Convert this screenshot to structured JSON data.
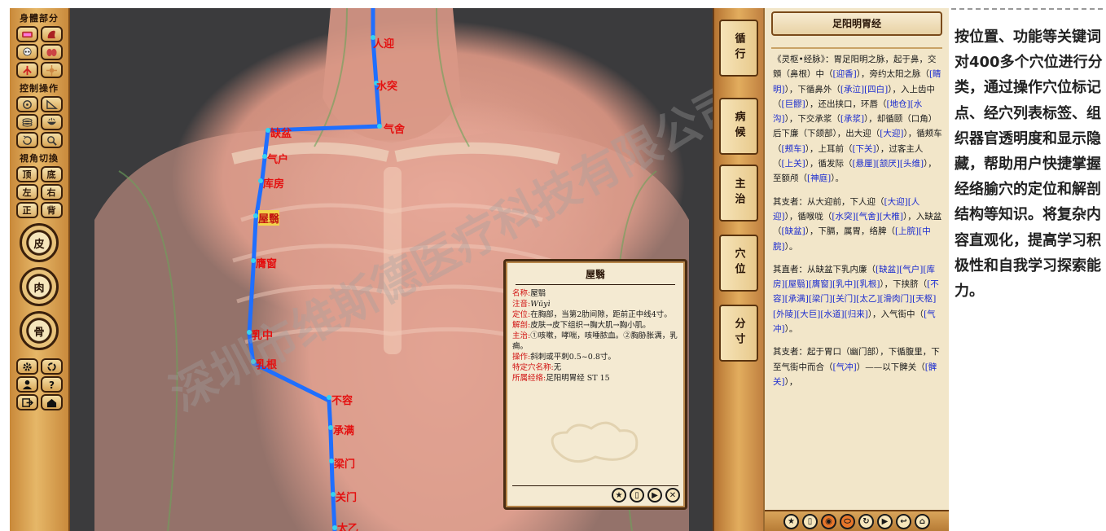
{
  "left_toolbar": {
    "section_body": "身體部分",
    "section_control": "控制操作",
    "section_view": "視角切換",
    "body_icons": [
      "skin-icon",
      "muscle-icon",
      "skull-icon",
      "organ-icon",
      "vessel-icon",
      "nerve-icon"
    ],
    "control_icons": [
      "rotate-icon",
      "measure-icon",
      "layers-icon",
      "bowl-icon",
      "reset-icon",
      "zoom-icon"
    ],
    "view_buttons": [
      "顶",
      "底",
      "左",
      "右",
      "正",
      "背"
    ],
    "ring_buttons": [
      "皮",
      "肉",
      "骨"
    ],
    "bottom_icons": [
      "settings-icon",
      "refresh-icon",
      "person-icon",
      "help-icon",
      "exit-icon",
      "home-icon"
    ]
  },
  "viewport": {
    "watermark": "深圳市维斯德医疗科技有限公司",
    "points": [
      {
        "label": "人迎"
      },
      {
        "label": "水突"
      },
      {
        "label": "气舍"
      },
      {
        "label": "缺盆"
      },
      {
        "label": "气户"
      },
      {
        "label": "库房"
      },
      {
        "label": "屋翳"
      },
      {
        "label": "膺窗"
      },
      {
        "label": "乳中"
      },
      {
        "label": "乳根"
      },
      {
        "label": "不容"
      },
      {
        "label": "承满"
      },
      {
        "label": "梁门"
      },
      {
        "label": "关门"
      },
      {
        "label": "太乙"
      }
    ]
  },
  "popup": {
    "title": "屋翳",
    "name_key": "名称:",
    "name_val": "屋翳",
    "pinyin_key": "注音:",
    "pinyin_val": "Wūyì",
    "location_key": "定位:",
    "location_val": "在胸部，当第2肋间隙，距前正中线4寸。",
    "anatomy_key": "解剖:",
    "anatomy_val": "皮肤→皮下组织→胸大肌→胸小肌。",
    "indication_key": "主治:",
    "indication_val": "①咳嗽，哮喘，咳唾脓血。②胸胁胀满，乳痈。",
    "method_key": "操作:",
    "method_val": "斜刺或平刺0.5~0.8寸。",
    "special_key": "特定穴名称:",
    "special_val": "无",
    "meridian_key": "所属经络:",
    "meridian_val": "足阳明胃经 ST 15",
    "buttons": [
      "star-icon",
      "note-icon",
      "play-icon",
      "close-icon"
    ]
  },
  "tabs": [
    "循行",
    "病候",
    "主治",
    "穴位",
    "分寸"
  ],
  "scroll_panel": {
    "title": "足阳明胃经",
    "p1": "《灵枢•经脉》：胃足阳明之脉，起于鼻，交頞（鼻根）中（[迎香]），旁约太阳之脉（[睛明]），下循鼻外（[承泣][四白]），入上齿中（[巨髎]），还出挟口，环唇（[地仓][水沟]），下交承浆（[承浆]），却循颐（口角）后下廉（下颌部），出大迎（[大迎]），循颊车（[颊车]），上耳前（[下关]），过客主人（[上关]），循发际（[悬厘][颔厌][头维]），至额颅（[神庭]）。",
    "p2": "其支者：从大迎前，下人迎（[大迎][人迎]），循喉咙（[水突][气舍][大椎]），入缺盆（[缺盆]），下膈，属胃，络脾（[上脘][中脘]）。",
    "p3": "其直者：从缺盆下乳内廉（[缺盆][气户][库房][屋翳][膺窗][乳中][乳根]），下挟脐（[不容][承满][梁门][关门][太乙][滑肉门][天枢][外陵][大巨][水道][归来]），入气街中（[气冲]）。",
    "p4": "其支者：起于胃口（幽门部），下循腹里，下至气街中而合（[气冲]）——以下髀关（[髀关]），",
    "bottom_icons": [
      "star-icon",
      "note-icon",
      "eye-icon",
      "pill-icon",
      "refresh-icon",
      "play-icon",
      "back-icon",
      "up-icon"
    ]
  },
  "description": "按位置、功能等关键词对400多个穴位进行分类，通过操作穴位标记点、经穴列表标签、组织器官透明度和显示隐藏，帮助用户快捷掌握经络腧穴的定位和解剖结构等知识。将复杂内容直观化，提高学习积极性和自我学习探索能力。"
}
